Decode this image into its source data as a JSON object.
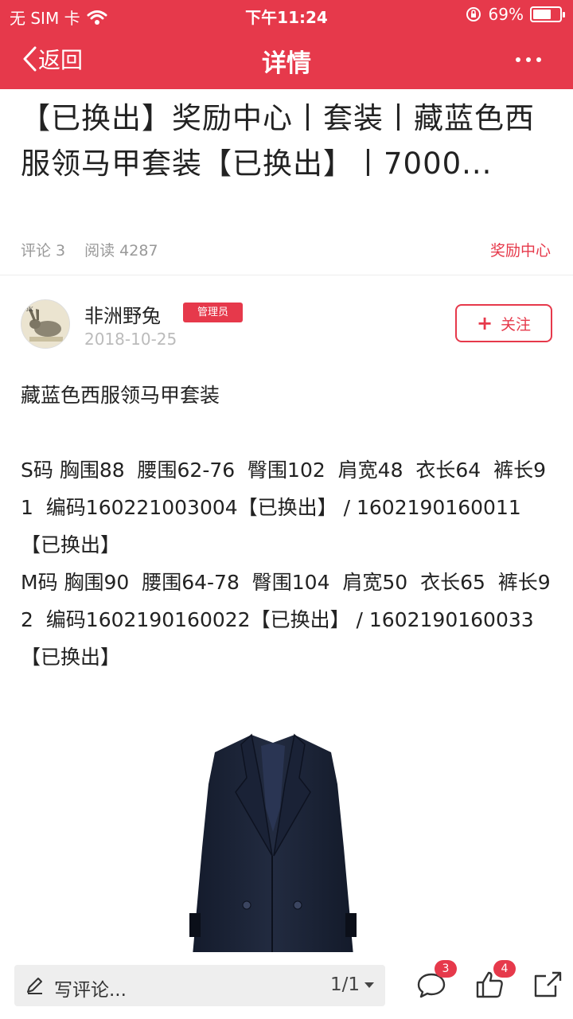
{
  "status_bar": {
    "carrier": "无 SIM 卡",
    "time": "下午11:24",
    "battery": "69%",
    "battery_level": 0.69
  },
  "nav": {
    "back_label": "返回",
    "title": "详情"
  },
  "article": {
    "title": "【已换出】奖励中心丨套装丨藏蓝色西服领马甲套装【已换出】丨7000...",
    "comments_label": "评论 3",
    "reads_label": "阅读 4287",
    "category": "奖励中心"
  },
  "author": {
    "name": "非洲野兔",
    "badge": "管理员",
    "date": "2018-10-25",
    "follow_label": "关注"
  },
  "content": {
    "heading": "藏蓝色西服领马甲套装",
    "size_s": "S码 胸围88  腰围62-76  臀围102  肩宽48  衣长64  裤长91  编码160221003004【已换出】 / 1602190160011【已换出】",
    "size_m": "M码 胸围90  腰围64-78  臀围104  肩宽50  衣长65  裤长92  编码1602190160022【已换出】 / 1602190160033【已换出】"
  },
  "bottom_bar": {
    "comment_placeholder": "写评论...",
    "page_indicator": "1/1",
    "comment_count": "3",
    "like_count": "4"
  },
  "colors": {
    "brand": "#e6394b",
    "text": "#222222",
    "muted": "#999999"
  }
}
